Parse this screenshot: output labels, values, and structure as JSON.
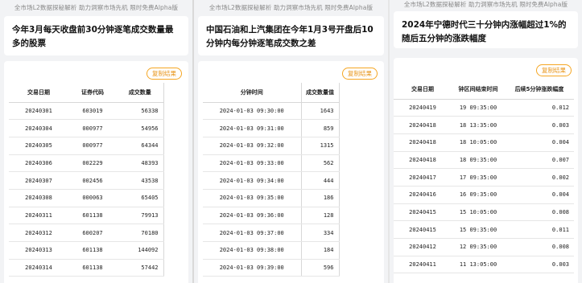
{
  "panels": [
    {
      "banner": "全市场L2数据探秘解析 助力洞察市场先机 限时免费Alpha版",
      "title": "今年3月每天收盘前30分钟逐笔成交数量最多的股票",
      "copy_label": "复制结果",
      "columns": [
        "交易日期",
        "证券代码",
        "成交数量"
      ],
      "rows": [
        [
          "20240301",
          "603019",
          "56338"
        ],
        [
          "20240304",
          "000977",
          "54956"
        ],
        [
          "20240305",
          "000977",
          "64344"
        ],
        [
          "20240306",
          "002229",
          "48393"
        ],
        [
          "20240307",
          "002456",
          "43538"
        ],
        [
          "20240308",
          "000063",
          "65405"
        ],
        [
          "20240311",
          "601138",
          "79913"
        ],
        [
          "20240312",
          "600207",
          "70180"
        ],
        [
          "20240313",
          "601138",
          "144092"
        ],
        [
          "20240314",
          "601138",
          "57442"
        ]
      ]
    },
    {
      "banner": "全市场L2数据探秘解析 助力洞察市场先机 限时免费Alpha版",
      "title": "中国石油和上汽集团在今年1月3号开盘后10分钟内每分钟逐笔成交数之差",
      "copy_label": "复制结果",
      "columns": [
        "分钟时间",
        "成交数量值"
      ],
      "rows": [
        [
          "2024-01-03  09:30:00",
          "1643"
        ],
        [
          "2024-01-03  09:31:00",
          "859"
        ],
        [
          "2024-01-03  09:32:00",
          "1315"
        ],
        [
          "2024-01-03  09:33:00",
          "562"
        ],
        [
          "2024-01-03  09:34:00",
          "444"
        ],
        [
          "2024-01-03  09:35:00",
          "186"
        ],
        [
          "2024-01-03  09:36:00",
          "128"
        ],
        [
          "2024-01-03  09:37:00",
          "334"
        ],
        [
          "2024-01-03  09:38:00",
          "184"
        ],
        [
          "2024-01-03  09:39:00",
          "596"
        ]
      ]
    },
    {
      "banner": "全市场L2数据探秘解析 助力洞察市场先机 限时免费Alpha版",
      "title": "2024年宁德时代三十分钟内涨幅超过1%的随后五分钟的涨跌幅度",
      "copy_label": "复制结果",
      "columns": [
        "交易日期",
        "钟区间结束时间",
        "后续5分钟涨跌幅度"
      ],
      "rows": [
        [
          "20240419",
          "19 09:35:00",
          "0.012"
        ],
        [
          "20240418",
          "18 13:35:00",
          "0.003"
        ],
        [
          "20240418",
          "18 10:05:00",
          "0.004"
        ],
        [
          "20240418",
          "18 09:35:00",
          "0.007"
        ],
        [
          "20240417",
          "17 09:35:00",
          "0.002"
        ],
        [
          "20240416",
          "16 09:35:00",
          "0.004"
        ],
        [
          "20240415",
          "15 10:05:00",
          "0.008"
        ],
        [
          "20240415",
          "15 09:35:00",
          "0.011"
        ],
        [
          "20240412",
          "12 09:35:00",
          "0.008"
        ],
        [
          "20240411",
          "11 13:05:00",
          "0.003"
        ]
      ]
    }
  ]
}
